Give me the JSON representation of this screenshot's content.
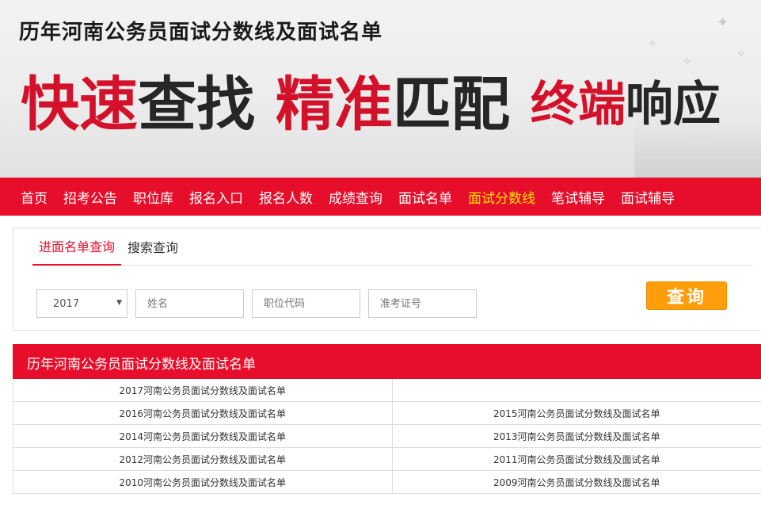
{
  "banner": {
    "title": "历年河南公务员面试分数线及面试名单",
    "slogan": {
      "r1": "快速",
      "d1": "查找",
      "r2": "精准",
      "d2": "匹配",
      "r3": "终端",
      "d3": "响应"
    }
  },
  "nav": {
    "items": [
      {
        "label": "首页"
      },
      {
        "label": "招考公告"
      },
      {
        "label": "职位库"
      },
      {
        "label": "报名入口"
      },
      {
        "label": "报名人数"
      },
      {
        "label": "成绩查询"
      },
      {
        "label": "面试名单"
      },
      {
        "label": "面试分数线"
      },
      {
        "label": "笔试辅导"
      },
      {
        "label": "面试辅导"
      }
    ],
    "active_index": 7
  },
  "search": {
    "tabs": [
      {
        "label": "进面名单查询"
      },
      {
        "label": "搜索查询"
      }
    ],
    "year": "2017",
    "name_placeholder": "姓名",
    "code_placeholder": "职位代码",
    "exam_placeholder": "准考证号",
    "button_label": "查询"
  },
  "list": {
    "title": "历年河南公务员面试分数线及面试名单",
    "rows": [
      [
        "2017河南公务员面试分数线及面试名单",
        ""
      ],
      [
        "2016河南公务员面试分数线及面试名单",
        "2015河南公务员面试分数线及面试名单"
      ],
      [
        "2014河南公务员面试分数线及面试名单",
        "2013河南公务员面试分数线及面试名单"
      ],
      [
        "2012河南公务员面试分数线及面试名单",
        "2011河南公务员面试分数线及面试名单"
      ],
      [
        "2010河南公务员面试分数线及面试名单",
        "2009河南公务员面试分数线及面试名单"
      ]
    ]
  }
}
